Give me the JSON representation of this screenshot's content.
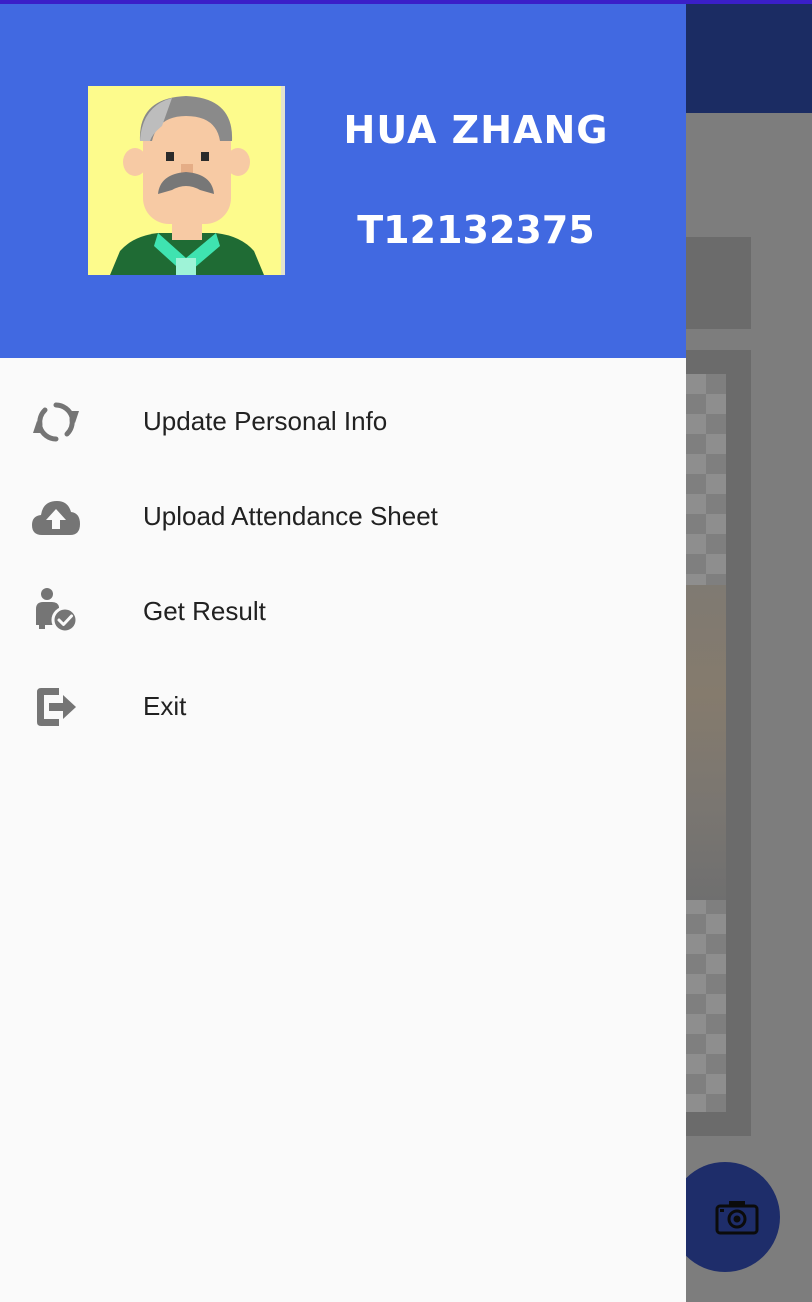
{
  "header": {
    "user_name": "HUA ZHANG",
    "user_id": "T12132375"
  },
  "menu": {
    "items": [
      {
        "label": "Update Personal Info",
        "icon": "sync-icon"
      },
      {
        "label": "Upload Attendance Sheet",
        "icon": "cloud-upload-icon"
      },
      {
        "label": "Get Result",
        "icon": "person-check-icon"
      },
      {
        "label": "Exit",
        "icon": "exit-icon"
      }
    ]
  },
  "fab": {
    "icon": "camera-icon"
  },
  "colors": {
    "header_bg": "#4169e1",
    "drawer_bg": "#fafafa",
    "icon_gray": "#757575",
    "toolbar_dimmed": "#1b2c63",
    "fab_dimmed": "#1e2d6a"
  }
}
